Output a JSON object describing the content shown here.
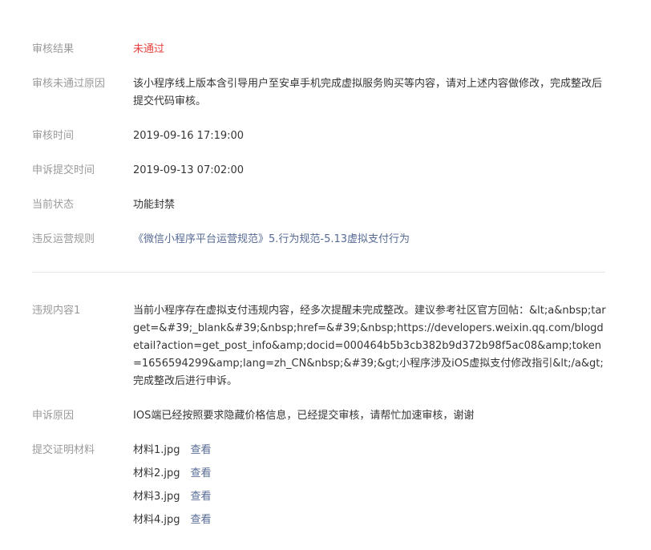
{
  "audit": {
    "result_label": "审核结果",
    "result_value": "未通过",
    "reason_label": "审核未通过原因",
    "reason_value": "该小程序线上版本含引导用户至安卓手机完成虚拟服务购买等内容，请对上述内容做修改，完成整改后提交代码审核。",
    "time_label": "审核时间",
    "time_value": "2019-09-16 17:19:00",
    "appeal_time_label": "申诉提交时间",
    "appeal_time_value": "2019-09-13 07:02:00",
    "status_label": "当前状态",
    "status_value": "功能封禁",
    "rule_label": "违反运营规则",
    "rule_value": "《微信小程序平台运营规范》5.行为规范-5.13虚拟支付行为"
  },
  "violation": {
    "content_label": "违规内容1",
    "content_value": "当前小程序存在虚拟支付违规内容，经多次提醒未完成整改。建议参考社区官方回帖：&lt;a&nbsp;target=&#39;_blank&#39;&nbsp;href=&#39;&nbsp;https://developers.weixin.qq.com/blogdetail?action=get_post_info&amp;docid=000464b5b3cb382b9d372b98f5ac08&amp;token=1656594299&amp;lang=zh_CN&nbsp;&#39;&gt;小程序涉及iOS虚拟支付修改指引&lt;/a&gt;完成整改后进行申诉。",
    "appeal_reason_label": "申诉原因",
    "appeal_reason_value": "IOS端已经按照要求隐藏价格信息，已经提交审核，请帮忙加速审核，谢谢",
    "materials_label": "提交证明材料",
    "view_label": "查看",
    "materials": [
      "材料1.jpg",
      "材料2.jpg",
      "材料3.jpg",
      "材料4.jpg"
    ]
  },
  "colors": {
    "fail": "#e64340",
    "link": "#576b95",
    "label": "#9a9a9a"
  }
}
